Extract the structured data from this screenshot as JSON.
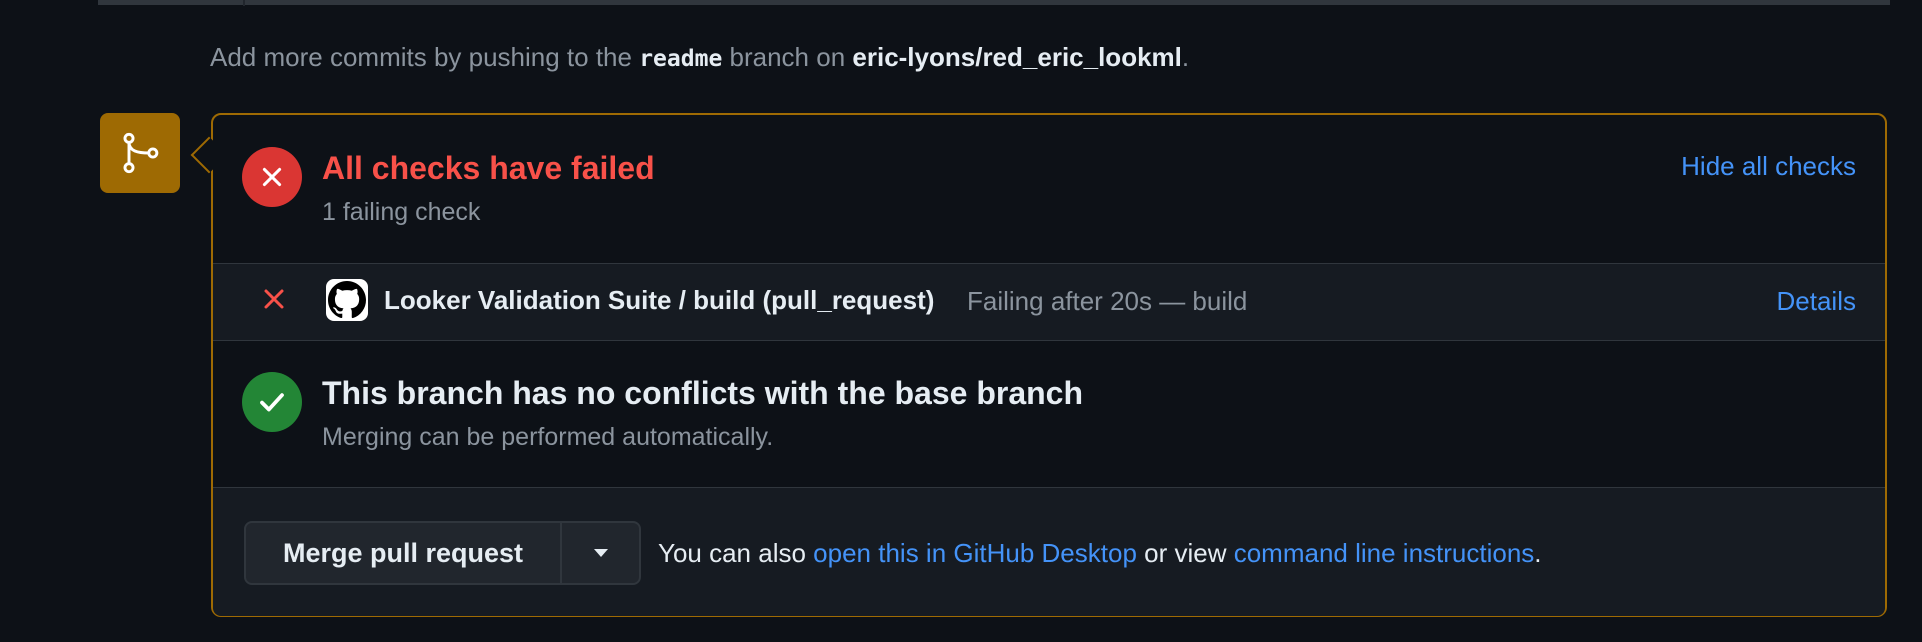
{
  "hint": {
    "prefix": "Add more commits by pushing to the ",
    "branch": "readme",
    "middle": " branch on ",
    "repo": "eric-lyons/red_eric_lookml",
    "suffix": "."
  },
  "checks": {
    "title": "All checks have failed",
    "subtitle": "1 failing check",
    "toggle_label": "Hide all checks",
    "items": [
      {
        "name": "Looker Validation Suite / build (pull_request)",
        "status": "Failing after 20s — build",
        "details_label": "Details"
      }
    ]
  },
  "conflicts": {
    "title": "This branch has no conflicts with the base branch",
    "subtitle": "Merging can be performed automatically."
  },
  "merge": {
    "button_label": "Merge pull request",
    "note_prefix": "You can also ",
    "desktop_link": "open this in GitHub Desktop",
    "note_middle": " or view ",
    "cli_link": "command line instructions",
    "note_suffix": "."
  },
  "colors": {
    "failure": "#da3633",
    "success": "#238636",
    "warning_border": "#9e6a03",
    "link": "#4493f8"
  },
  "icons": {
    "badge": "git-merge-icon",
    "failure": "x-circle-icon",
    "success": "check-circle-icon",
    "row_status": "x-icon",
    "app": "github-logo-icon",
    "dropdown": "triangle-down-icon"
  }
}
